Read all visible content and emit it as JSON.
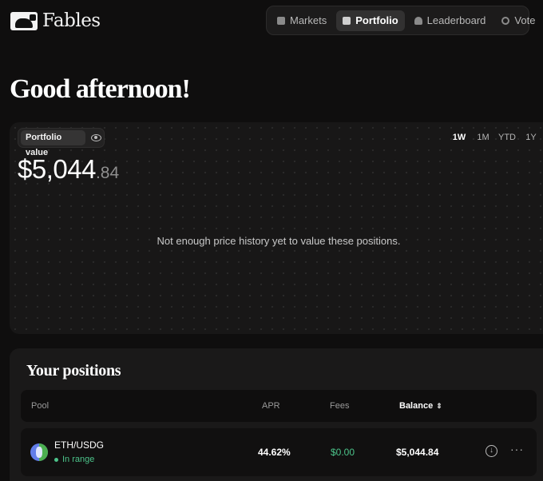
{
  "app": {
    "name": "Fables"
  },
  "nav": {
    "items": [
      {
        "label": "Markets",
        "icon": "markets-icon"
      },
      {
        "label": "Portfolio",
        "icon": "portfolio-icon",
        "active": true
      },
      {
        "label": "Leaderboard",
        "icon": "trophy-icon"
      },
      {
        "label": "Vote",
        "icon": "gauge-icon"
      }
    ]
  },
  "greeting": "Good afternoon!",
  "portfolio": {
    "label": "Portfolio value",
    "value_main": "$5,044",
    "value_cents": ".84",
    "ranges": [
      "1W",
      "1M",
      "YTD",
      "1Y"
    ],
    "active_range": "1W",
    "empty_message": "Not enough price history yet to value these positions."
  },
  "positions": {
    "title": "Your positions",
    "columns": {
      "pool": "Pool",
      "apr": "APR",
      "fees": "Fees",
      "balance": "Balance"
    },
    "rows": [
      {
        "pair": "ETH/USDG",
        "status": "In range",
        "apr": "44.62%",
        "fees": "$0.00",
        "balance": "$5,044.84"
      }
    ]
  },
  "colors": {
    "background": "#0f0e0e",
    "card": "#181717",
    "positive": "#4cc38a"
  }
}
